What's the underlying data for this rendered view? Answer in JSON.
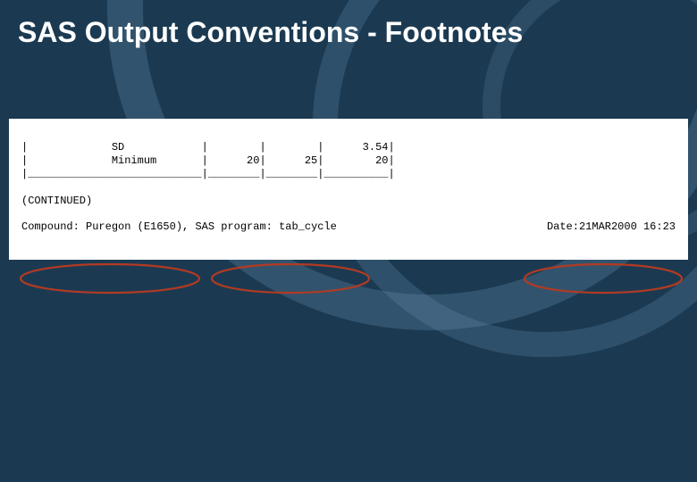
{
  "title": "SAS Output Conventions - Footnotes",
  "table": {
    "row1": "|             SD            |        |        |      3.54|",
    "row2": "|             Minimum       |      20|      25|        20|",
    "separator": "|___________________________|________|________|__________|"
  },
  "continued": "(CONTINUED)",
  "footnote": {
    "compound_label": "Compound:",
    "compound_value": "Puregon (E1650),",
    "program_label": "SAS program:",
    "program_value": "tab_cycle",
    "date_label": "Date:",
    "date_value": "21MAR2000 16:23"
  }
}
